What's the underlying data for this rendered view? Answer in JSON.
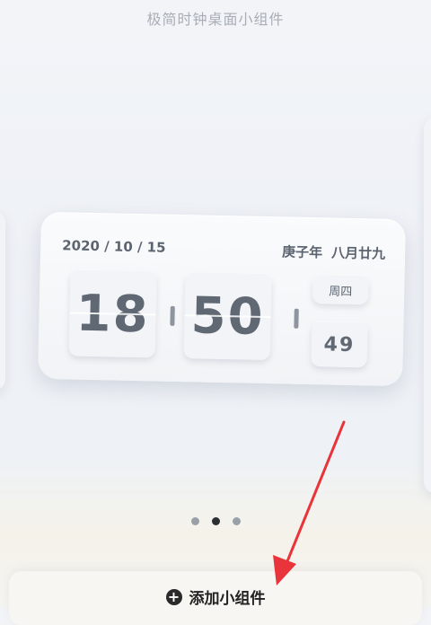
{
  "header": {
    "title": "极简时钟桌面小组件"
  },
  "widget": {
    "date": "2020 / 10 / 15",
    "lunar_year": "庚子年",
    "lunar_date": "八月廿九",
    "hour": "18",
    "minute": "50",
    "weekday": "周四",
    "second": "49"
  },
  "pager": {
    "count": 3,
    "active_index": 1
  },
  "footer": {
    "add_label": "添加小组件",
    "add_icon": "plus-circle-icon"
  },
  "annotation": {
    "arrow_color": "#e8343a"
  }
}
